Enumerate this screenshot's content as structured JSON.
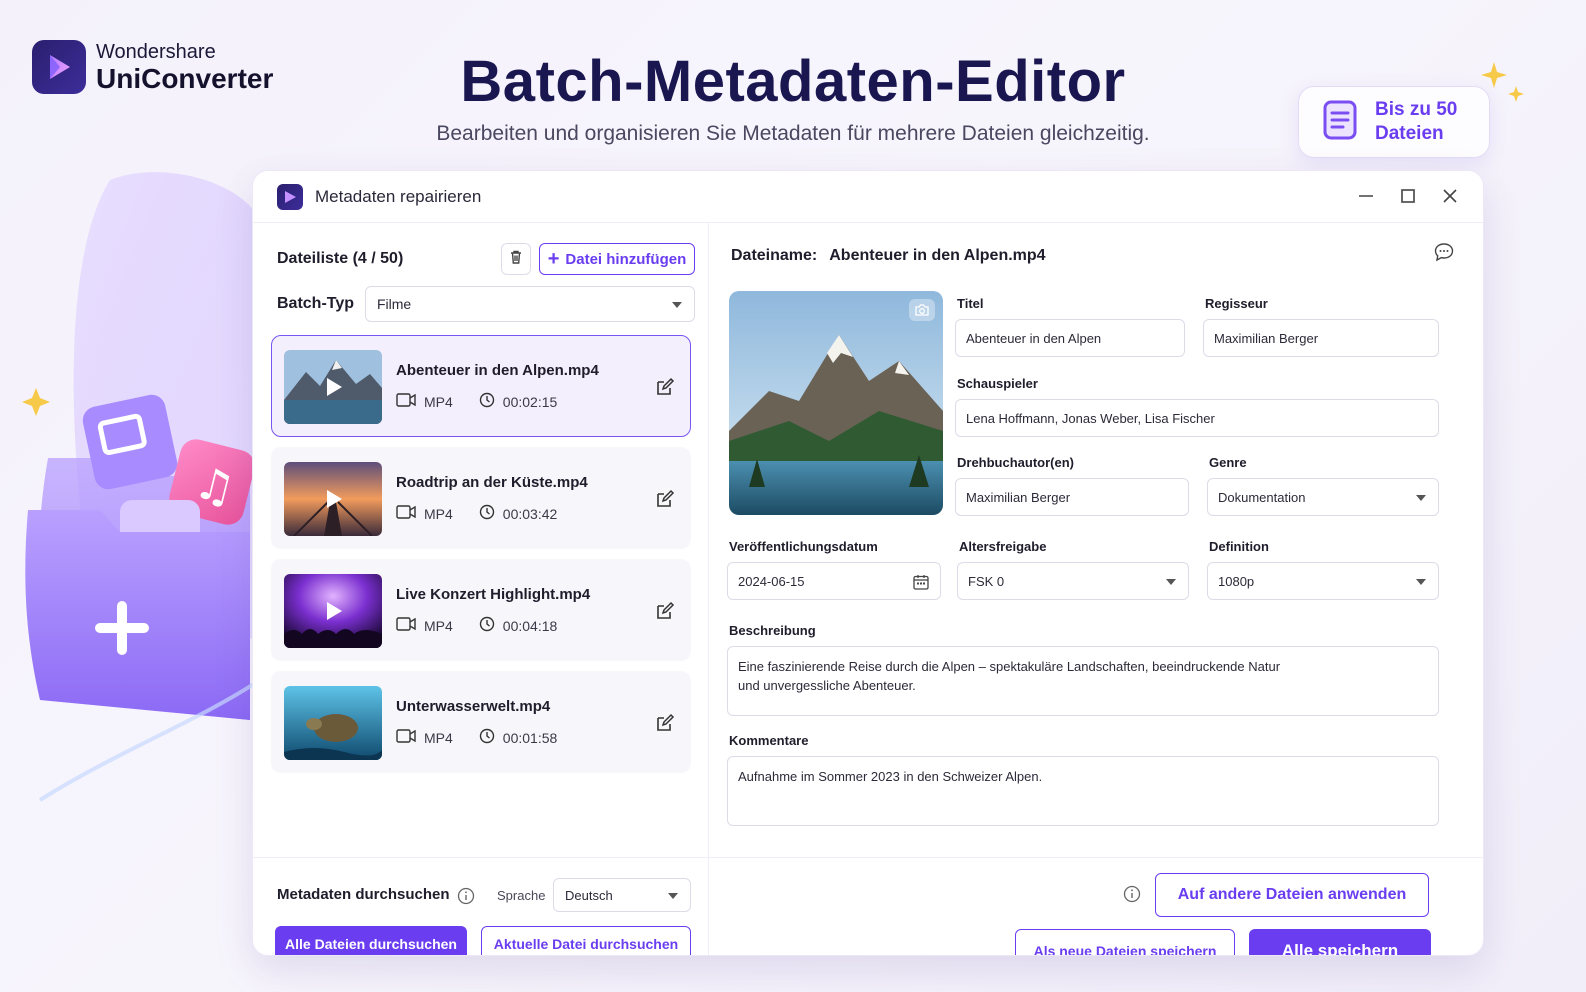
{
  "brand": {
    "company": "Wondershare",
    "product": "UniConverter"
  },
  "hero": {
    "title": "Batch-Metadaten-Editor",
    "subtitle": "Bearbeiten und organisieren Sie Metadaten für mehrere Dateien gleichzeitig."
  },
  "badge": {
    "text": "Bis zu 50 Dateien",
    "icon": "document-list-icon"
  },
  "window": {
    "title": "Metadaten repairieren",
    "controls": [
      "minimize-icon",
      "maximize-icon",
      "close-icon"
    ]
  },
  "file_list": {
    "title": "Dateiliste (4 / 50)",
    "add_label": "Datei hinzufügen",
    "batch_type_label": "Batch-Typ",
    "batch_type_value": "Filme",
    "items": [
      {
        "name": "Abenteuer in den Alpen.mp4",
        "format": "MP4",
        "duration": "00:02:15",
        "active": true
      },
      {
        "name": "Roadtrip an der Küste.mp4",
        "format": "MP4",
        "duration": "00:03:42",
        "active": false
      },
      {
        "name": "Live Konzert Highlight.mp4",
        "format": "MP4",
        "duration": "00:04:18",
        "active": false
      },
      {
        "name": "Unterwasserwelt.mp4",
        "format": "MP4",
        "duration": "00:01:58",
        "active": false
      }
    ]
  },
  "search": {
    "label": "Metadaten durchsuchen",
    "language_label": "Sprache",
    "language_value": "Deutsch",
    "search_all": "Alle Dateien durchsuchen",
    "search_current": "Aktuelle Datei durchsuchen"
  },
  "details": {
    "filename_label": "Dateiname:",
    "filename_value": "Abenteuer in den Alpen.mp4",
    "title_label": "Titel",
    "title_value": "Abenteuer in den Alpen",
    "director_label": "Regisseur",
    "director_value": "Maximilian Berger",
    "actors_label": "Schauspieler",
    "actors_value": "Lena Hoffmann, Jonas Weber, Lisa Fischer",
    "writers_label": "Drehbuchautor(en)",
    "writers_value": "Maximilian Berger",
    "genre_label": "Genre",
    "genre_value": "Dokumentation",
    "release_label": "Veröffentlichungsdatum",
    "release_value": "2024-06-15",
    "rating_label": "Altersfreigabe",
    "rating_value": "FSK 0",
    "definition_label": "Definition",
    "definition_value": "1080p",
    "description_label": "Beschreibung",
    "description_line1": "Eine faszinierende Reise durch die Alpen – spektakuläre Landschaften, beeindruckende Natur",
    "description_line2": "und unvergessliche Abenteuer.",
    "comments_label": "Kommentare",
    "comments_value": "Aufnahme im Sommer 2023 in den Schweizer Alpen."
  },
  "actions": {
    "apply_others": "Auf andere Dateien anwenden",
    "save_as_new": "Als neue Dateien speichern",
    "save_all": "Alle speichern"
  },
  "colors": {
    "accent": "#6a3ef0",
    "title": "#1a1650",
    "active_bg": "#f3effd"
  }
}
